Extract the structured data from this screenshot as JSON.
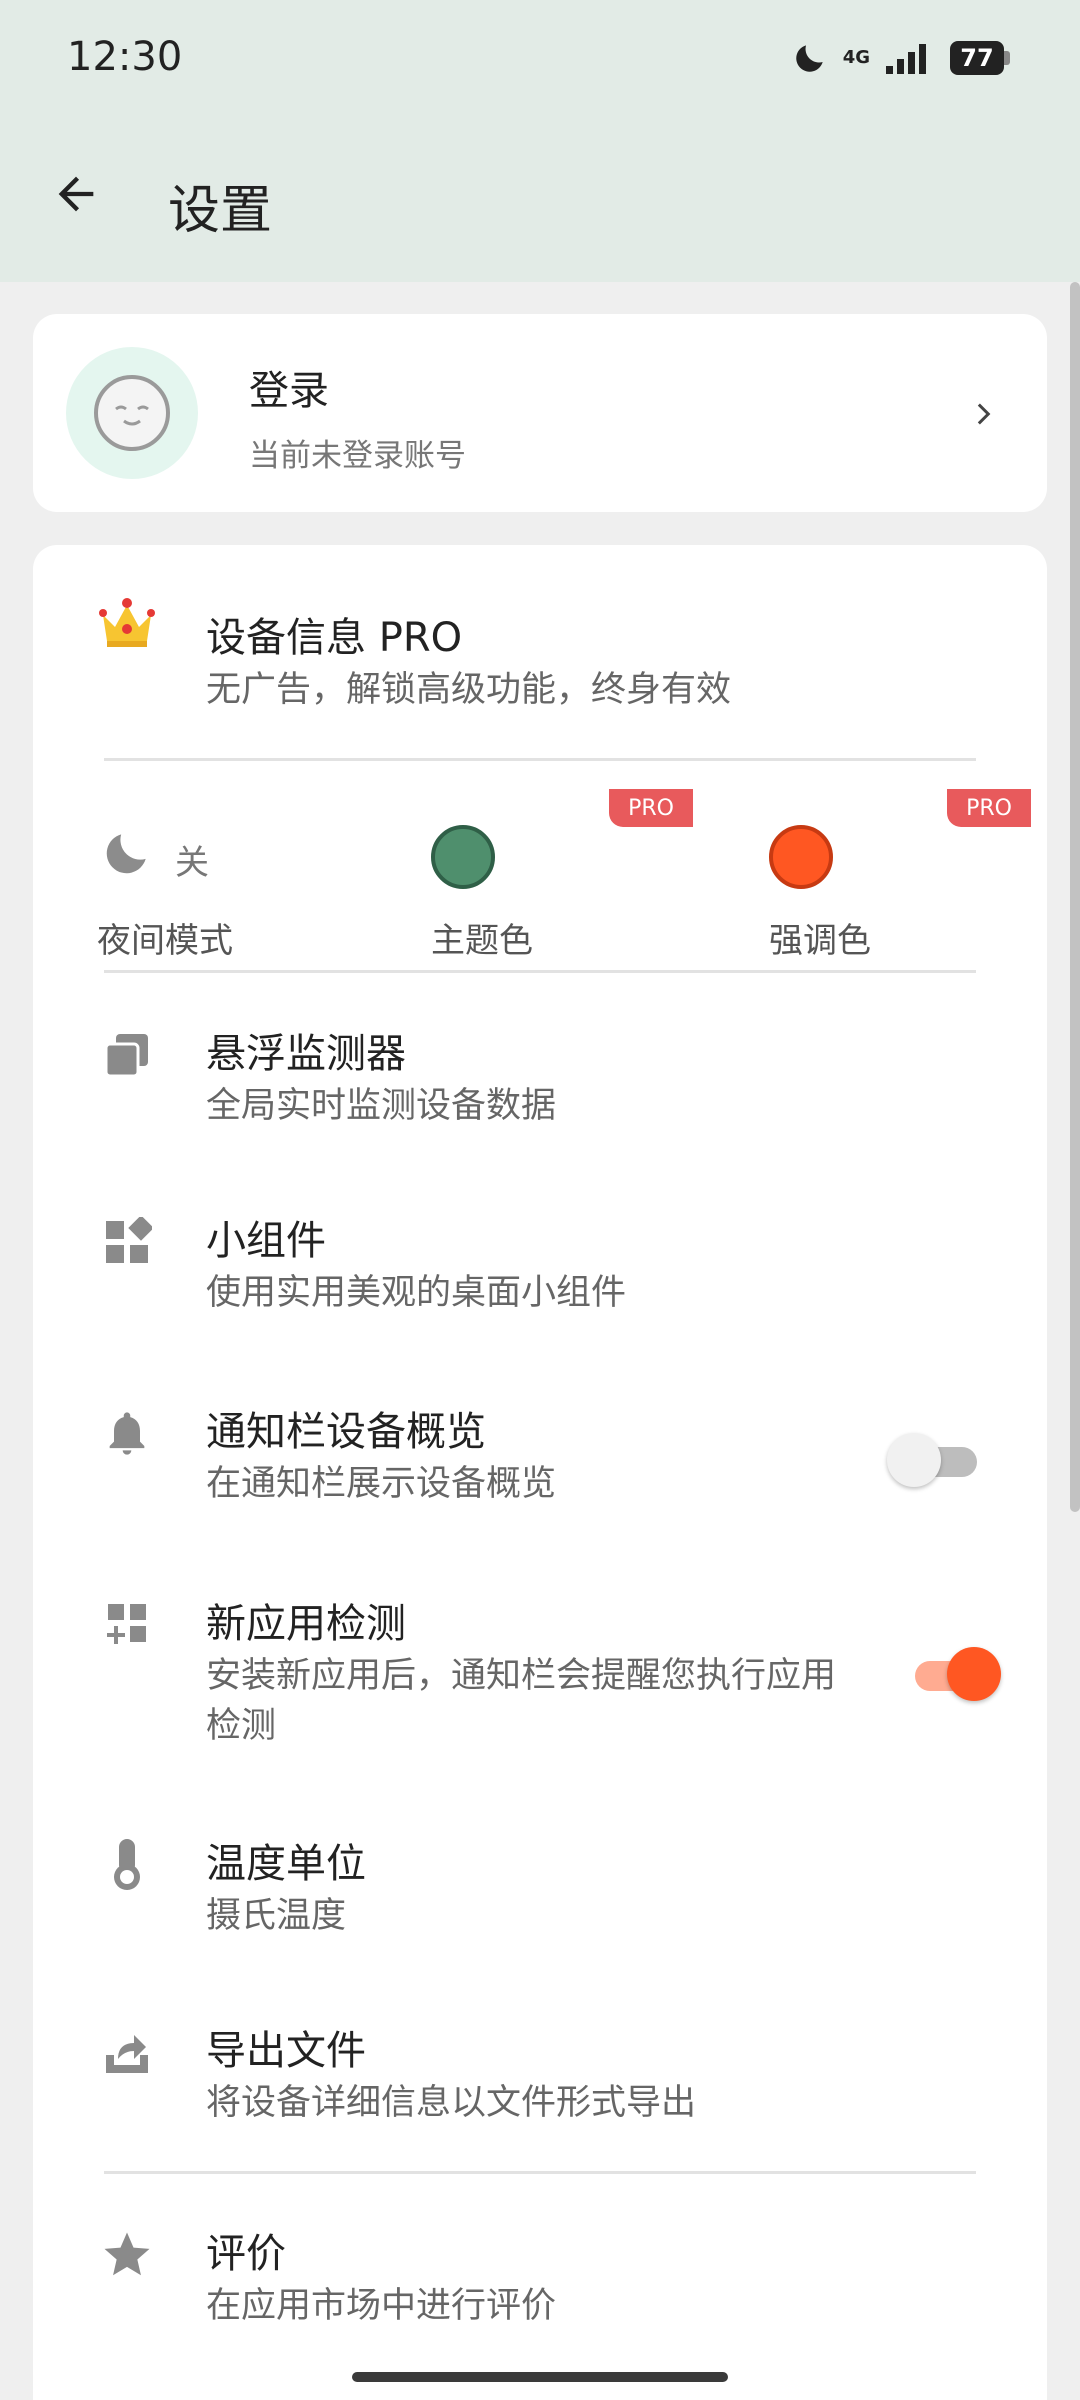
{
  "status_bar": {
    "time": "12:30",
    "network": "4G",
    "battery": "77"
  },
  "app_bar": {
    "title": "设置"
  },
  "login": {
    "title": "登录",
    "subtitle": "当前未登录账号"
  },
  "pro": {
    "title": "设备信息 PRO",
    "subtitle": "无广告，解锁高级功能，终身有效"
  },
  "quick_options": {
    "night_mode_state": "关",
    "night_mode_label": "夜间模式",
    "theme_color_label": "主题色",
    "accent_color_label": "强调色",
    "pro_badge": "PRO",
    "theme_color": "#4f8f6d",
    "accent_color": "#ff5722"
  },
  "settings": [
    {
      "title": "悬浮监测器",
      "subtitle": "全局实时监测设备数据",
      "icon": "copy-icon"
    },
    {
      "title": "小组件",
      "subtitle": "使用实用美观的桌面小组件",
      "icon": "widgets-icon"
    },
    {
      "title": "通知栏设备概览",
      "subtitle": "在通知栏展示设备概览",
      "icon": "bell-icon",
      "toggle_on": false
    },
    {
      "title": "新应用检测",
      "subtitle": "安装新应用后，通知栏会提醒您执行应用检测",
      "icon": "app-add-icon",
      "toggle_on": true
    },
    {
      "title": "温度单位",
      "subtitle": "摄氏温度",
      "icon": "thermometer-icon"
    },
    {
      "title": "导出文件",
      "subtitle": "将设备详细信息以文件形式导出",
      "icon": "export-icon"
    },
    {
      "title": "评价",
      "subtitle": "在应用市场中进行评价",
      "icon": "star-icon"
    }
  ],
  "colors": {
    "accent": "#ff5722",
    "header_bg": "#e2ebe6",
    "page_bg": "#efefef"
  }
}
